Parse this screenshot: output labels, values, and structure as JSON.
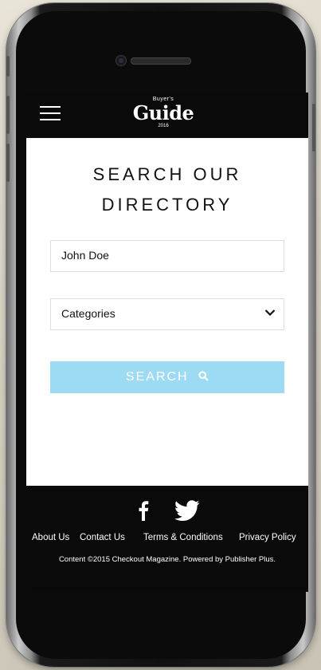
{
  "header": {
    "logo_top": "Buyer's",
    "logo_main": "Guide",
    "logo_year": "2016"
  },
  "main": {
    "title_line1": "SEARCH OUR",
    "title_line2": "DIRECTORY",
    "name_input_value": "John Doe",
    "category_select_value": "Categories",
    "search_button_label": "SEARCH"
  },
  "footer": {
    "links": [
      "About Us",
      "Contact Us",
      "Terms & Conditions",
      "Privacy Policy"
    ],
    "copyright": "Content ©2015 Checkout Magazine. Powered by Publisher Plus."
  },
  "colors": {
    "accent": "#9ddaf4",
    "header_bg": "#0a0a0a",
    "footer_bg": "#0a0a0a"
  },
  "icons": [
    "menu-icon",
    "chevron-down-icon",
    "search-icon",
    "facebook-icon",
    "twitter-icon"
  ]
}
